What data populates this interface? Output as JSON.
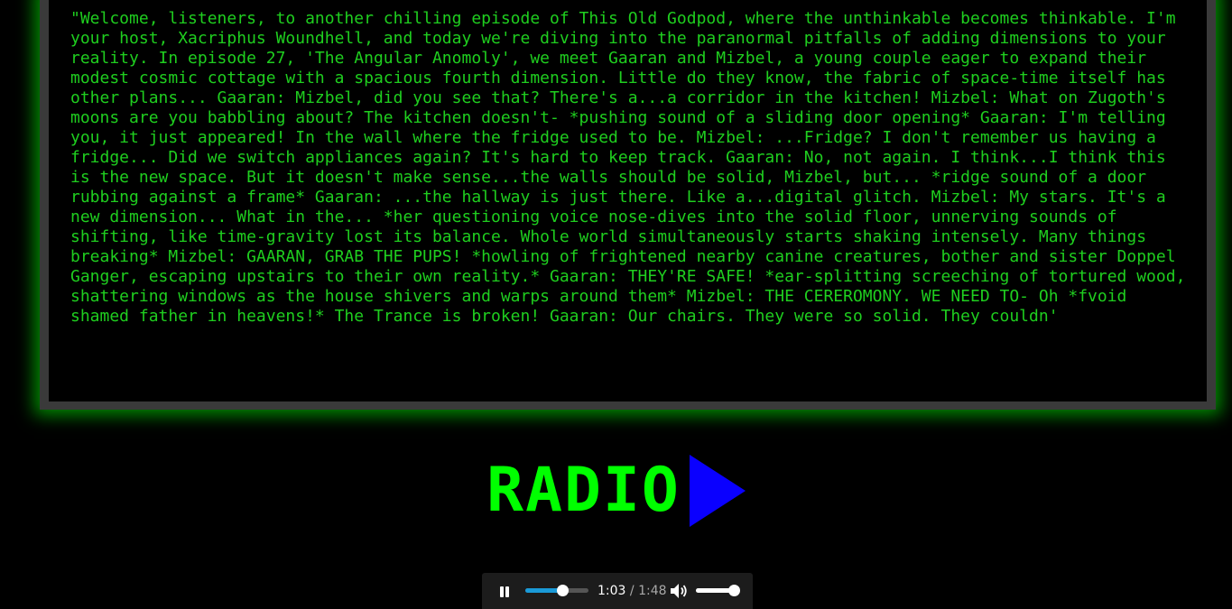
{
  "transcript": {
    "text": "\"Welcome, listeners, to another chilling episode of This Old Godpod, where the unthinkable becomes thinkable. I'm your host, Xacriphus Woundhell, and today we're diving into the paranormal pitfalls of adding dimensions to your reality. In episode 27, 'The Angular Anomoly', we meet Gaaran and Mizbel, a young couple eager to expand their modest cosmic cottage with a spacious fourth dimension. Little do they know, the fabric of space-time itself has other plans... Gaaran: Mizbel, did you see that? There's a...a corridor in the kitchen! Mizbel: What on Zugoth's moons are you babbling about? The kitchen doesn't- *pushing sound of a sliding door opening* Gaaran: I'm telling you, it just appeared! In the wall where the fridge used to be. Mizbel: ...Fridge? I don't remember us having a fridge... Did we switch appliances again? It's hard to keep track. Gaaran: No, not again. I think...I think this is the new space. But it doesn't make sense...the walls should be solid, Mizbel, but... *ridge sound of a door rubbing against a frame* Gaaran: ...the hallway is just there. Like a...digital glitch. Mizbel: My stars. It's a new dimension... What in the... *her questioning voice nose-dives into the solid floor, unnerving sounds of shifting, like time-gravity lost its balance. Whole world simultaneously starts shaking intensely. Many things breaking* Mizbel: GAARAN, GRAB THE PUPS! *howling of frightened nearby canine creatures, bother and sister Doppel Ganger, escaping upstairs to their own reality.* Gaaran: THEY'RE SAFE! *ear-splitting screeching of tortured wood, shattering windows as the house shivers and warps around them* Mizbel: THE CEREROMONY. WE NEED TO- Oh *fvoid shamed father in heavens!* The Trance is broken! Gaaran: Our chairs. They were so solid. They couldn'"
  },
  "header": {
    "radio_label": "RADIO",
    "play_icon": "play-triangle-icon"
  },
  "player": {
    "current_time": "1:03",
    "separator": "/",
    "duration": "1:48",
    "progress_fraction": 0.583,
    "volume_fraction": 1.0,
    "pause_icon": "pause-icon",
    "volume_icon": "speaker-volume-icon"
  },
  "colors": {
    "text_green": "#1fce1f",
    "title_green": "#00ff00",
    "play_blue": "#0a00ff",
    "frame_gray": "#3a3a3a",
    "seek_blue": "#1a9ad8"
  }
}
